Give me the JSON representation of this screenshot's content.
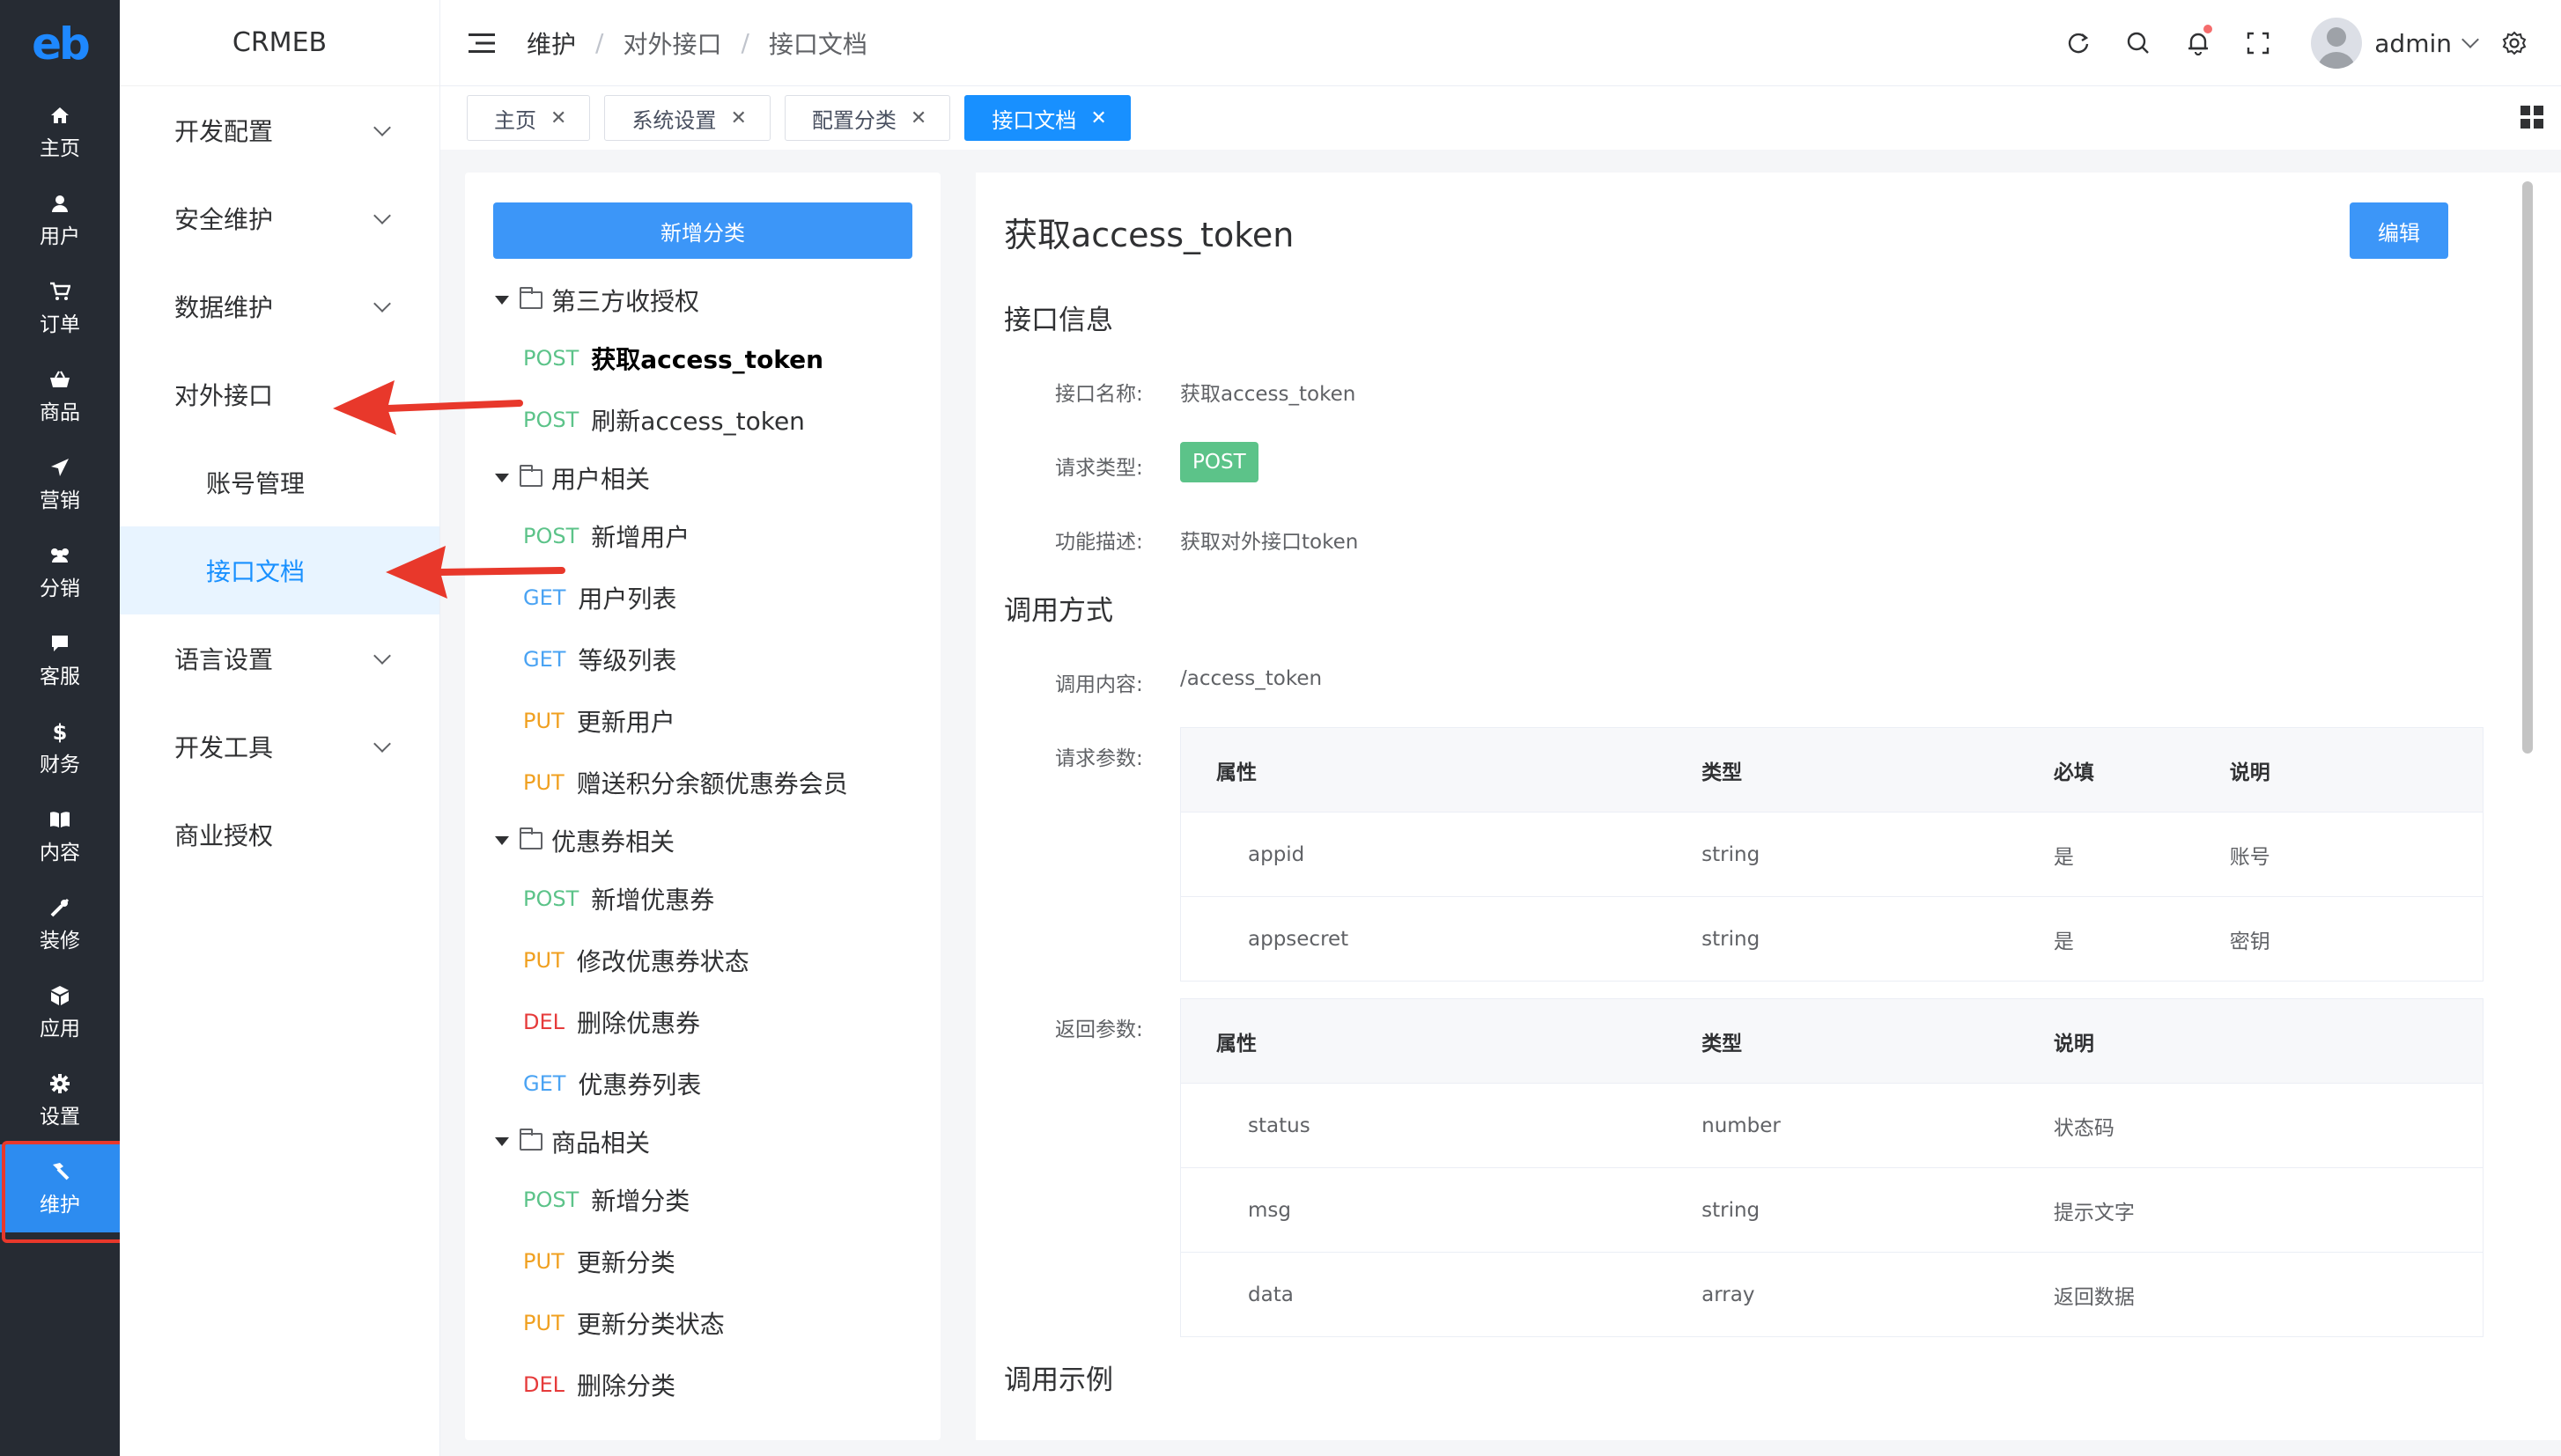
{
  "rail": {
    "items": [
      {
        "label": "主页",
        "icon": "home-icon"
      },
      {
        "label": "用户",
        "icon": "user-icon"
      },
      {
        "label": "订单",
        "icon": "cart-icon"
      },
      {
        "label": "商品",
        "icon": "basket-icon"
      },
      {
        "label": "营销",
        "icon": "send-icon"
      },
      {
        "label": "分销",
        "icon": "users-icon"
      },
      {
        "label": "客服",
        "icon": "chat-icon"
      },
      {
        "label": "财务",
        "icon": "dollar-icon"
      },
      {
        "label": "内容",
        "icon": "book-icon"
      },
      {
        "label": "装修",
        "icon": "tools-icon"
      },
      {
        "label": "应用",
        "icon": "cube-icon"
      },
      {
        "label": "设置",
        "icon": "gear-icon"
      },
      {
        "label": "维护",
        "icon": "hammer-icon"
      }
    ],
    "active_index": 12
  },
  "menu": {
    "brand": "CRMEB",
    "items": [
      {
        "label": "开发配置",
        "expandable": true
      },
      {
        "label": "安全维护",
        "expandable": true
      },
      {
        "label": "数据维护",
        "expandable": true
      },
      {
        "label": "对外接口",
        "expandable": false
      },
      {
        "label": "账号管理",
        "sub": true
      },
      {
        "label": "接口文档",
        "sub": true,
        "active": true
      },
      {
        "label": "语言设置",
        "expandable": true
      },
      {
        "label": "开发工具",
        "expandable": true
      },
      {
        "label": "商业授权",
        "expandable": false
      }
    ]
  },
  "header": {
    "breadcrumb": [
      "维护",
      "对外接口",
      "接口文档"
    ],
    "username": "admin",
    "icons": [
      "refresh-icon",
      "search-icon",
      "bell-icon",
      "fullscreen-icon",
      "settings-icon"
    ]
  },
  "tabs": [
    {
      "label": "主页",
      "active": false
    },
    {
      "label": "系统设置",
      "active": false
    },
    {
      "label": "配置分类",
      "active": false
    },
    {
      "label": "接口文档",
      "active": true
    }
  ],
  "tree": {
    "add_button": "新增分类",
    "method_colors": {
      "POST": "#5cc389",
      "GET": "#4aa3f3",
      "PUT": "#f0a020",
      "DEL": "#e63b3b"
    },
    "groups": [
      {
        "name": "第三方收授权",
        "apis": [
          {
            "method": "POST",
            "name": "获取access_token",
            "selected": true
          },
          {
            "method": "POST",
            "name": "刷新access_token"
          }
        ]
      },
      {
        "name": "用户相关",
        "apis": [
          {
            "method": "POST",
            "name": "新增用户"
          },
          {
            "method": "GET",
            "name": "用户列表"
          },
          {
            "method": "GET",
            "name": "等级列表"
          },
          {
            "method": "PUT",
            "name": "更新用户"
          },
          {
            "method": "PUT",
            "name": "赠送积分余额优惠券会员"
          }
        ]
      },
      {
        "name": "优惠券相关",
        "apis": [
          {
            "method": "POST",
            "name": "新增优惠券"
          },
          {
            "method": "PUT",
            "name": "修改优惠券状态"
          },
          {
            "method": "DEL",
            "name": "删除优惠券"
          },
          {
            "method": "GET",
            "name": "优惠券列表"
          }
        ]
      },
      {
        "name": "商品相关",
        "apis": [
          {
            "method": "POST",
            "name": "新增分类"
          },
          {
            "method": "PUT",
            "name": "更新分类"
          },
          {
            "method": "PUT",
            "name": "更新分类状态"
          },
          {
            "method": "DEL",
            "name": "删除分类"
          }
        ]
      }
    ]
  },
  "detail": {
    "title": "获取access_token",
    "edit_button": "编辑",
    "info_section": "接口信息",
    "name_label": "接口名称:",
    "name_value": "获取access_token",
    "method_label": "请求类型:",
    "method_value": "POST",
    "desc_label": "功能描述:",
    "desc_value": "获取对外接口token",
    "call_section": "调用方式",
    "content_label": "调用内容:",
    "content_value": "/access_token",
    "req_label": "请求参数:",
    "req_table": {
      "headers": [
        "属性",
        "类型",
        "必填",
        "说明"
      ],
      "rows": [
        [
          "appid",
          "string",
          "是",
          "账号"
        ],
        [
          "appsecret",
          "string",
          "是",
          "密钥"
        ]
      ]
    },
    "resp_label": "返回参数:",
    "resp_table": {
      "headers": [
        "属性",
        "类型",
        "说明"
      ],
      "rows": [
        [
          "status",
          "number",
          "状态码"
        ],
        [
          "msg",
          "string",
          "提示文字"
        ],
        [
          "data",
          "array",
          "返回数据"
        ]
      ]
    },
    "example_section": "调用示例"
  },
  "colors": {
    "accent": "#1890ff",
    "rail_bg": "#262b33",
    "highlight": "#e8382b"
  }
}
